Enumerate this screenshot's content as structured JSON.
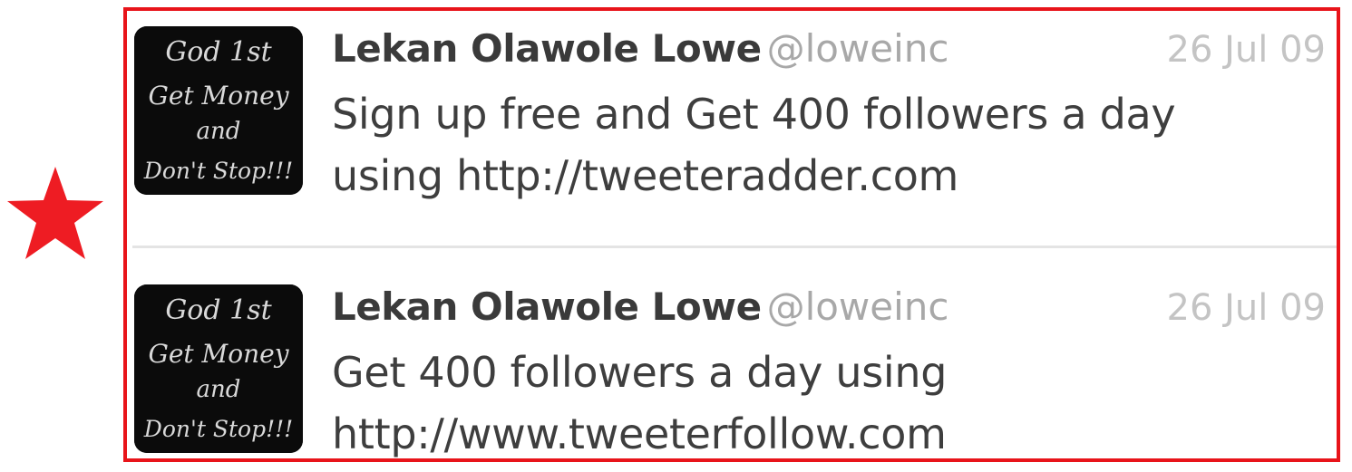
{
  "highlight": {
    "star_icon": "star-icon",
    "frame_color": "#e8141a"
  },
  "tweets": [
    {
      "avatar_text": [
        "God 1st",
        "Get Money",
        "and",
        "Don't Stop!!!"
      ],
      "name": "Lekan Olawole Lowe",
      "handle": "@loweinc",
      "date": "26 Jul 09",
      "lines": [
        "Sign up free and Get 400 followers a day",
        "using http://tweeteradder.com"
      ]
    },
    {
      "avatar_text": [
        "God 1st",
        "Get Money",
        "and",
        "Don't Stop!!!"
      ],
      "name": "Lekan Olawole Lowe",
      "handle": "@loweinc",
      "date": "26 Jul 09",
      "lines": [
        "Get 400 followers a day using",
        "http://www.tweeterfollow.com"
      ]
    }
  ]
}
